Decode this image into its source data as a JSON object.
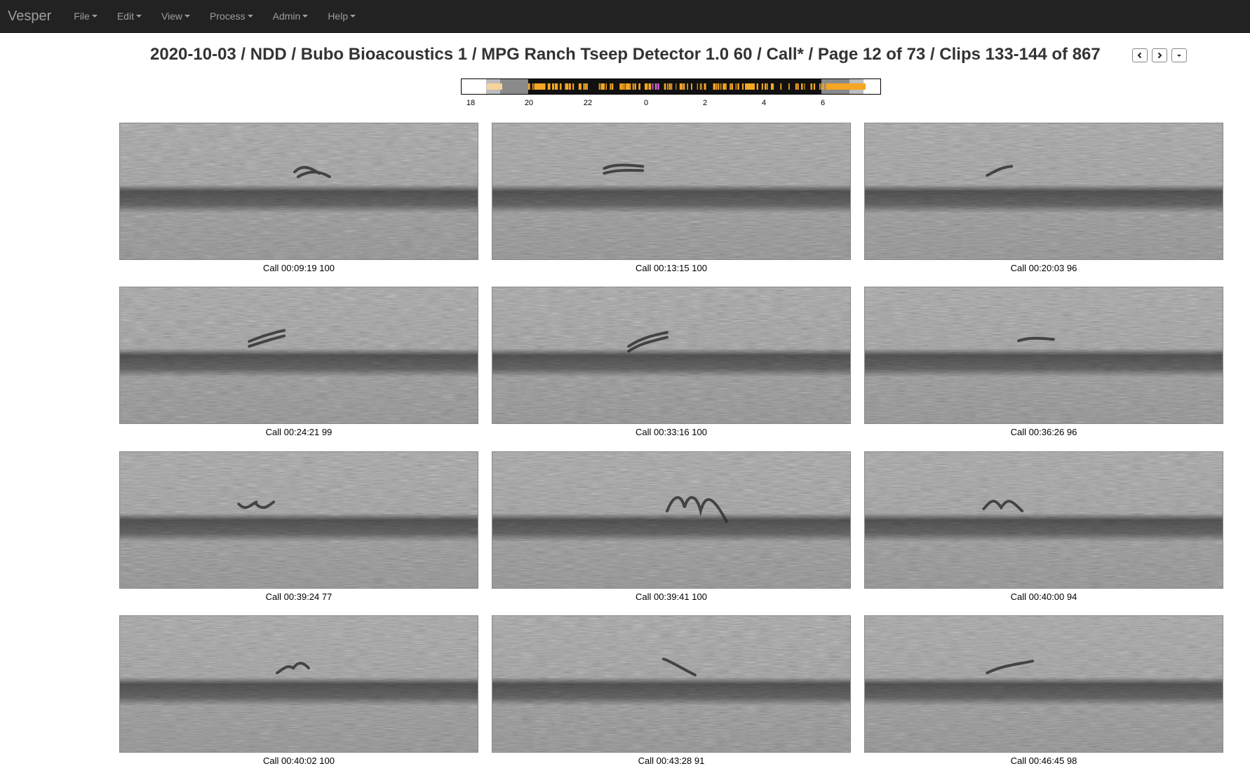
{
  "navbar": {
    "brand": "Vesper",
    "menus": [
      "File",
      "Edit",
      "View",
      "Process",
      "Admin",
      "Help"
    ]
  },
  "header": {
    "title": "2020-10-03 / NDD / Bubo Bioacoustics 1 / MPG Ranch Tseep Detector 1.0 60 / Call* / Page 12 of 73 / Clips 133-144 of 867"
  },
  "rug": {
    "tick_labels": [
      "18",
      "20",
      "22",
      "0",
      "2",
      "4",
      "6"
    ]
  },
  "clips": [
    {
      "label": "Call 00:09:19 100"
    },
    {
      "label": "Call 00:13:15 100"
    },
    {
      "label": "Call 00:20:03 96"
    },
    {
      "label": "Call 00:24:21 99"
    },
    {
      "label": "Call 00:33:16 100"
    },
    {
      "label": "Call 00:36:26 96"
    },
    {
      "label": "Call 00:39:24 77"
    },
    {
      "label": "Call 00:39:41 100"
    },
    {
      "label": "Call 00:40:00 94"
    },
    {
      "label": "Call 00:40:02 100"
    },
    {
      "label": "Call 00:43:28 91"
    },
    {
      "label": "Call 00:46:45 98"
    }
  ]
}
